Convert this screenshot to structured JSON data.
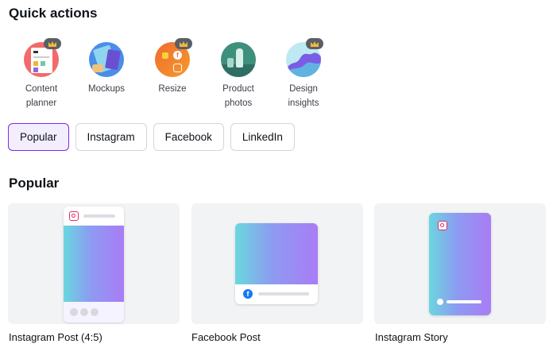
{
  "quick_actions": {
    "title": "Quick actions",
    "items": [
      {
        "line1": "Content",
        "line2": "planner",
        "icon": "content-planner-icon",
        "premium": true
      },
      {
        "line1": "Mockups",
        "line2": "",
        "icon": "mockups-icon",
        "premium": false
      },
      {
        "line1": "Resize",
        "line2": "",
        "icon": "resize-icon",
        "premium": true
      },
      {
        "line1": "Product",
        "line2": "photos",
        "icon": "product-photos-icon",
        "premium": false
      },
      {
        "line1": "Design",
        "line2": "insights",
        "icon": "design-insights-icon",
        "premium": true
      }
    ]
  },
  "tabs": [
    {
      "label": "Popular",
      "active": true
    },
    {
      "label": "Instagram",
      "active": false
    },
    {
      "label": "Facebook",
      "active": false
    },
    {
      "label": "LinkedIn",
      "active": false
    }
  ],
  "popular": {
    "title": "Popular",
    "cards": [
      {
        "label": "Instagram Post (4:5)",
        "icon": "instagram-icon"
      },
      {
        "label": "Facebook Post",
        "icon": "facebook-icon"
      },
      {
        "label": "Instagram Story",
        "icon": "instagram-icon"
      }
    ]
  },
  "colors": {
    "accent": "#7d2ae8",
    "active_tab_bg": "#f3eefe",
    "card_bg": "#f2f3f5",
    "crown_badge": "#5a5f66"
  }
}
